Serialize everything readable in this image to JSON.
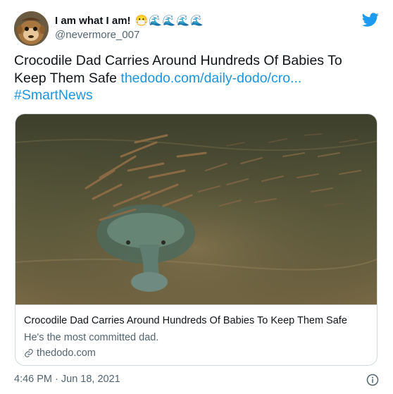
{
  "user": {
    "display_name": "I am what I am!",
    "emoji_badges": [
      "😷",
      "🌊",
      "🌊",
      "🌊",
      "🌊"
    ],
    "handle": "@nevermore_007",
    "avatar_icon": "monkey-avatar"
  },
  "tweet": {
    "text": "Crocodile Dad Carries Around Hundreds Of Babies To Keep Them Safe",
    "link_text": "thedodo.com/daily-dodo/cro...",
    "hashtag": "#SmartNews"
  },
  "card": {
    "image_icon": "crocodile-photo",
    "title": "Crocodile Dad Carries Around Hundreds Of Babies To Keep Them Safe",
    "description": "He's the most committed dad.",
    "domain": "thedodo.com"
  },
  "meta": {
    "timestamp": "4:46 PM · Jun 18, 2021"
  },
  "colors": {
    "link": "#1b95e0",
    "twitter_blue": "#1d9bf0",
    "muted": "#536471",
    "border": "#cfd9de"
  }
}
